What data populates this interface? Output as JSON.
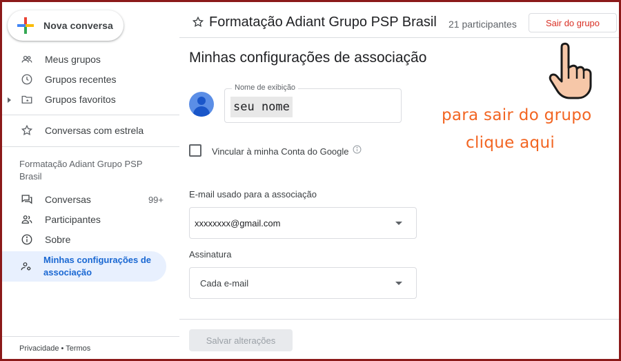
{
  "sidebar": {
    "new_conversation": "Nova conversa",
    "items_top": [
      {
        "label": "Meus grupos",
        "icon": "groups-icon"
      },
      {
        "label": "Grupos recentes",
        "icon": "clock-icon"
      },
      {
        "label": "Grupos favoritos",
        "icon": "folder-star-icon"
      }
    ],
    "starred": "Conversas com estrela",
    "group_title": "Formatação Adiant Grupo PSP Brasil",
    "items_group": [
      {
        "label": "Conversas",
        "count": "99+",
        "icon": "conversations-icon"
      },
      {
        "label": "Participantes",
        "icon": "people-icon"
      },
      {
        "label": "Sobre",
        "icon": "info-icon"
      }
    ],
    "active_item": "Minhas configurações de associação",
    "footer": "Privacidade • Termos"
  },
  "header": {
    "group_name": "Formatação Adiant Grupo PSP Brasil",
    "participants": "21 participantes",
    "leave_button": "Sair do grupo"
  },
  "main": {
    "title": "Minhas configurações de associação",
    "display_name_label": "Nome de exibição",
    "display_name_value": "seu nome",
    "link_google_label": "Vincular à minha Conta do Google",
    "email_section_label": "E-mail usado para a associação",
    "email_value": "xxxxxxxx@gmail.com",
    "subscription_label": "Assinatura",
    "subscription_value": "Cada e-mail",
    "save_button": "Salvar alterações"
  },
  "annotation": {
    "line1": "para sair do grupo",
    "line2": "clique aqui",
    "color": "#f26522"
  },
  "colors": {
    "accent": "#1967d2",
    "active_bg": "#e8f0fe",
    "leave_text": "#d93025",
    "frame": "#8b1a1a"
  }
}
